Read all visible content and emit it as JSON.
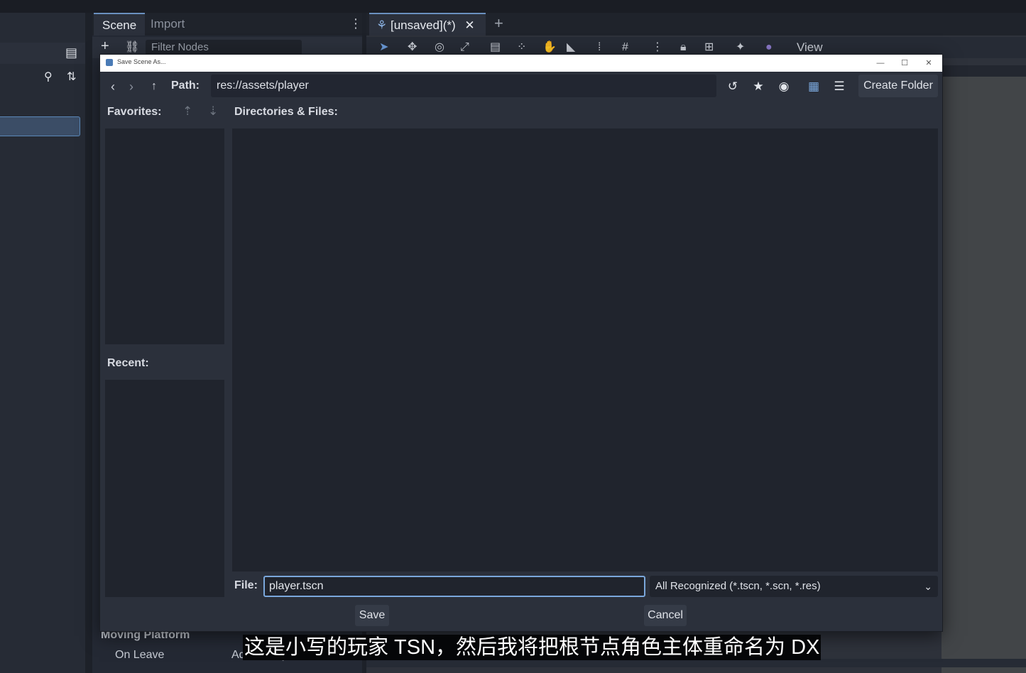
{
  "editor": {
    "scene_tab": "Scene",
    "import_tab": "Import",
    "filter_placeholder": "Filter Nodes",
    "viewport_tab": "[unsaved](*)",
    "view_menu": "View",
    "props": {
      "moving_platform": "Moving Platform",
      "on_leave": "On Leave",
      "add_button": "Add Ready"
    }
  },
  "dialog": {
    "title": "Save Scene As...",
    "path_label": "Path:",
    "path_value": "res://assets/player",
    "create_folder": "Create Folder",
    "favorites_label": "Favorites:",
    "recent_label": "Recent:",
    "dirs_label": "Directories & Files:",
    "file_label": "File:",
    "file_value": "player.tscn",
    "filter_value": "All Recognized (*.tscn, *.scn, *.res)",
    "save_button": "Save",
    "cancel_button": "Cancel"
  },
  "subtitle": "这是小写的玩家 TSN，然后我将把根节点角色主体重命名为 DX",
  "colors": {
    "accent": "#7aa7db",
    "panel": "#2b303b",
    "field": "#20242d"
  }
}
